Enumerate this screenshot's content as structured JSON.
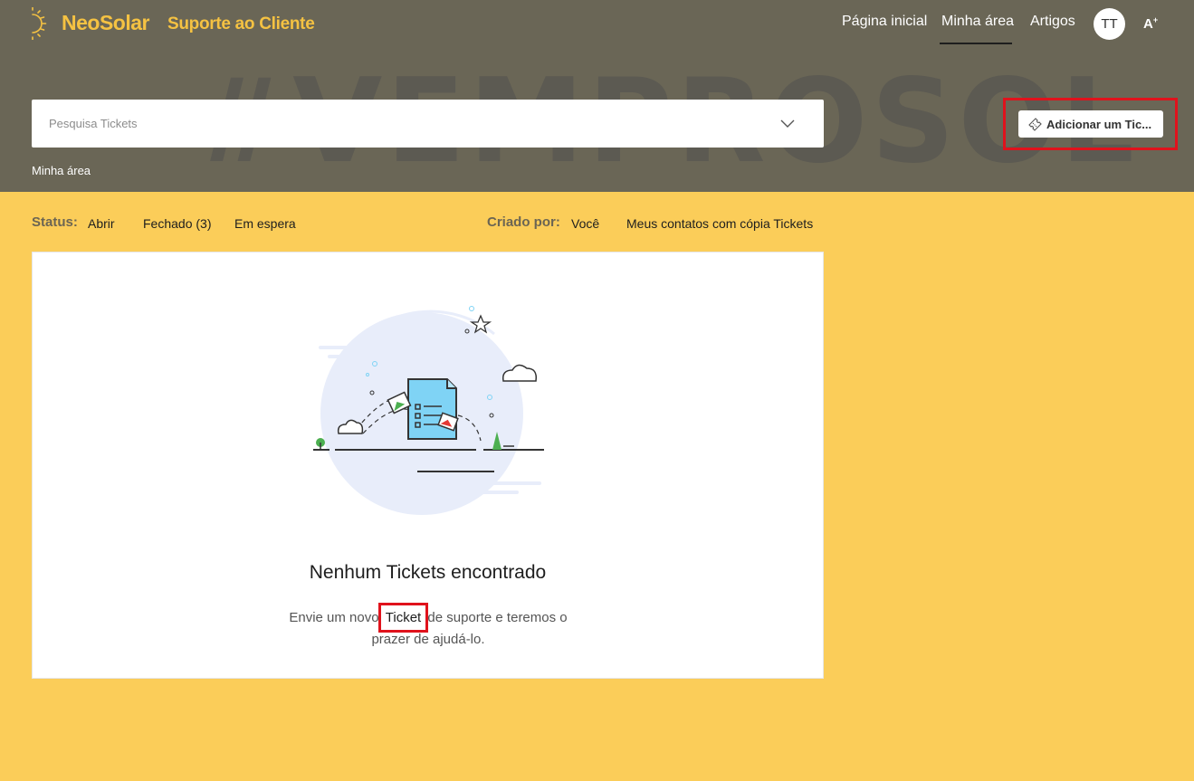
{
  "brand": {
    "name": "NeoSolar",
    "subtitle": "Suporte ao Cliente"
  },
  "nav": {
    "home": "Página inicial",
    "my_area": "Minha área",
    "articles": "Artigos",
    "avatar_initials": "TT",
    "font_size_icon": "font-size-icon"
  },
  "hero": {
    "watermark": "#VEMPROSOL",
    "search_placeholder": "Pesquisa Tickets",
    "search_value": "",
    "add_ticket_label": "Adicionar um Tic...",
    "breadcrumb": "Minha área"
  },
  "filters": {
    "status_label": "Status:",
    "status_options": [
      "Abrir",
      "Fechado (3)",
      "Em espera"
    ],
    "created_by_label": "Criado por:",
    "created_by_options": [
      "Você",
      "Meus contatos com cópia Tickets"
    ]
  },
  "empty_state": {
    "title": "Nenhum Tickets encontrado",
    "desc_before": "Envie um novo ",
    "desc_highlight": "Ticket",
    "desc_after": " de suporte e teremos o prazer de ajudá-lo."
  },
  "colors": {
    "hero_bg": "#6A6656",
    "page_bg": "#FBCD59",
    "brand": "#F5C242",
    "highlight_box": "#E0121C"
  }
}
